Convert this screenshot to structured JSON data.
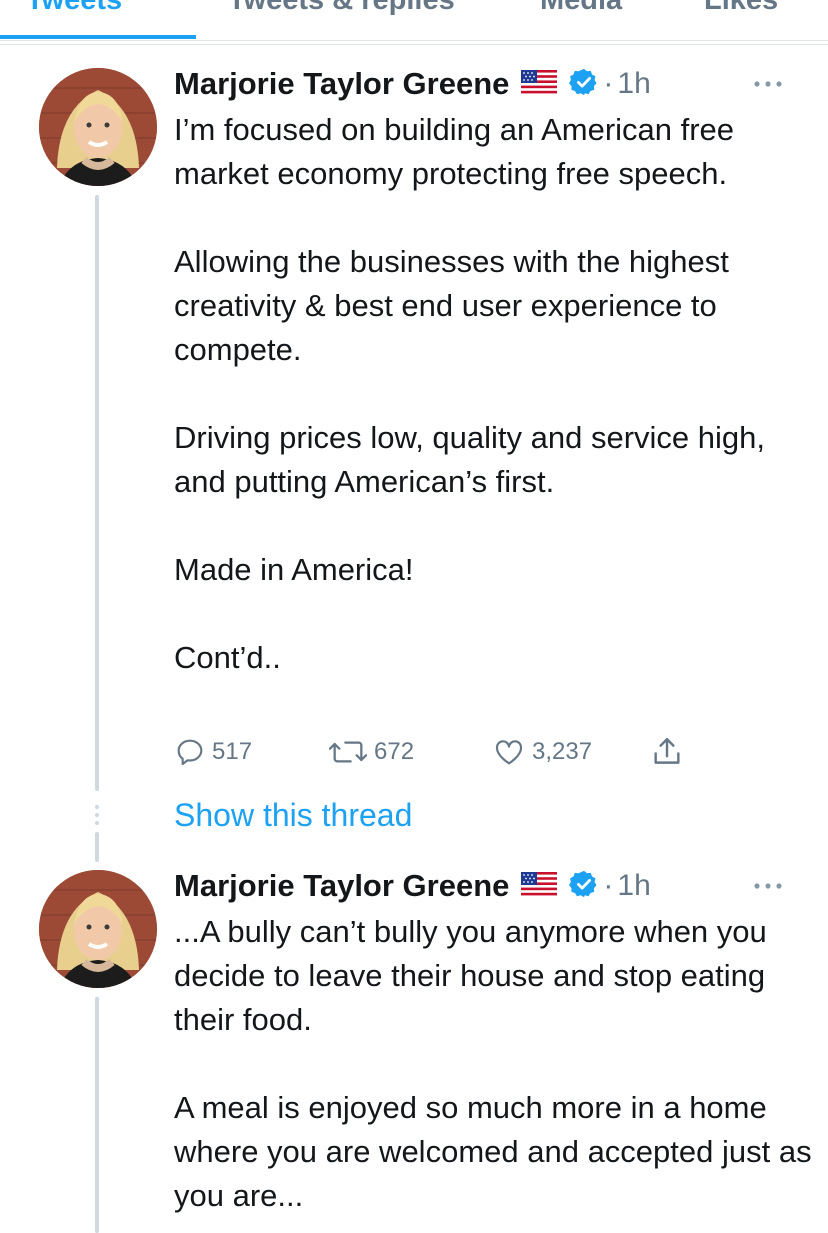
{
  "tabs": [
    {
      "label": "Tweets",
      "active": true
    },
    {
      "label": "Tweets & replies",
      "active": false
    },
    {
      "label": "Media",
      "active": false
    },
    {
      "label": "Likes",
      "active": false
    }
  ],
  "tweets": [
    {
      "author": "Marjorie Taylor Greene",
      "time": "1h",
      "separator": "·",
      "paragraphs": [
        "I’m focused on building an American free market economy protecting free speech.",
        "Allowing the businesses with the highest creativity & best end user experience to compete.",
        "Driving prices low, quality and service high, and putting American’s first.",
        "Made in America!",
        "Cont’d.."
      ],
      "replies": "517",
      "retweets": "672",
      "likes": "3,237"
    },
    {
      "author": "Marjorie Taylor Greene",
      "time": "1h",
      "separator": "·",
      "paragraphs": [
        "...A bully can’t bully you anymore when you decide to leave their house and stop eating their food.",
        "A meal is enjoyed so much more in a home where you are welcomed and accepted just as you are..."
      ]
    }
  ],
  "show_thread": "Show this thread",
  "icons": {
    "flag": "us-flag-icon",
    "verified": "verified-badge-icon",
    "more": "more-options-icon",
    "reply": "reply-icon",
    "retweet": "retweet-icon",
    "like": "like-icon",
    "share": "share-icon"
  },
  "colors": {
    "accent": "#1da1f2",
    "text": "#14171a",
    "muted": "#657786",
    "thread_line": "#cfd9de"
  }
}
